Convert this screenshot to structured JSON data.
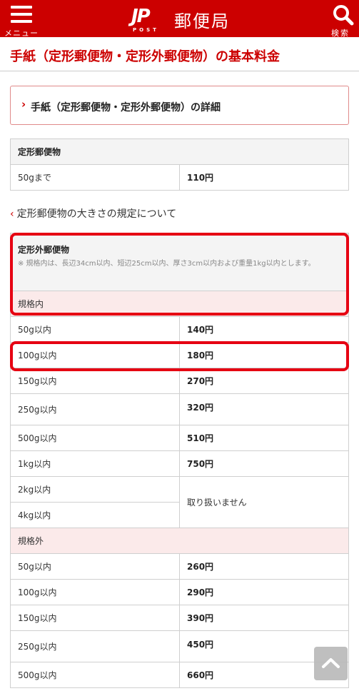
{
  "header": {
    "menu_label": "メニュー",
    "logo_mark": "JP",
    "logo_sub": "POST",
    "logo_text": "郵便局",
    "search_label": "検索",
    "bg_color": "#cc0000"
  },
  "page": {
    "title": "手紙（定形郵便物・定形外郵便物）の基本料金",
    "detail_link": "手紙（定形郵便物・定形外郵便物）の詳細",
    "size_link": "定形郵便物の大きさの規定について"
  },
  "teikei": {
    "header": "定形郵便物",
    "rows": [
      {
        "weight": "50gまで",
        "price": "110円"
      }
    ]
  },
  "teikeigai": {
    "header": "定形外郵便物",
    "note": "※ 規格内は、長辺34cm以内、短辺25cm以内、厚さ3cm以内および重量1kg以内とします。",
    "standard_label": "規格内",
    "standard_rows": [
      {
        "weight": "50g以内",
        "price": "140円"
      },
      {
        "weight": "100g以内",
        "price": "180円"
      },
      {
        "weight": "150g以内",
        "price": "270円"
      },
      {
        "weight": "250g以内",
        "price": "320円"
      },
      {
        "weight": "500g以内",
        "price": "510円"
      },
      {
        "weight": "1kg以内",
        "price": "750円"
      },
      {
        "weight": "2kg以内",
        "price": "取り扱いません"
      },
      {
        "weight": "4kg以内",
        "price": ""
      }
    ],
    "nonstandard_label": "規格外",
    "nonstandard_rows": [
      {
        "weight": "50g以内",
        "price": "260円"
      },
      {
        "weight": "100g以内",
        "price": "290円"
      },
      {
        "weight": "150g以内",
        "price": "390円"
      },
      {
        "weight": "250g以内",
        "price": "450円"
      },
      {
        "weight": "500g以内",
        "price": "660円"
      }
    ]
  },
  "highlight_color": "#e60012",
  "back_to_top_icon": "chevron-up-icon"
}
